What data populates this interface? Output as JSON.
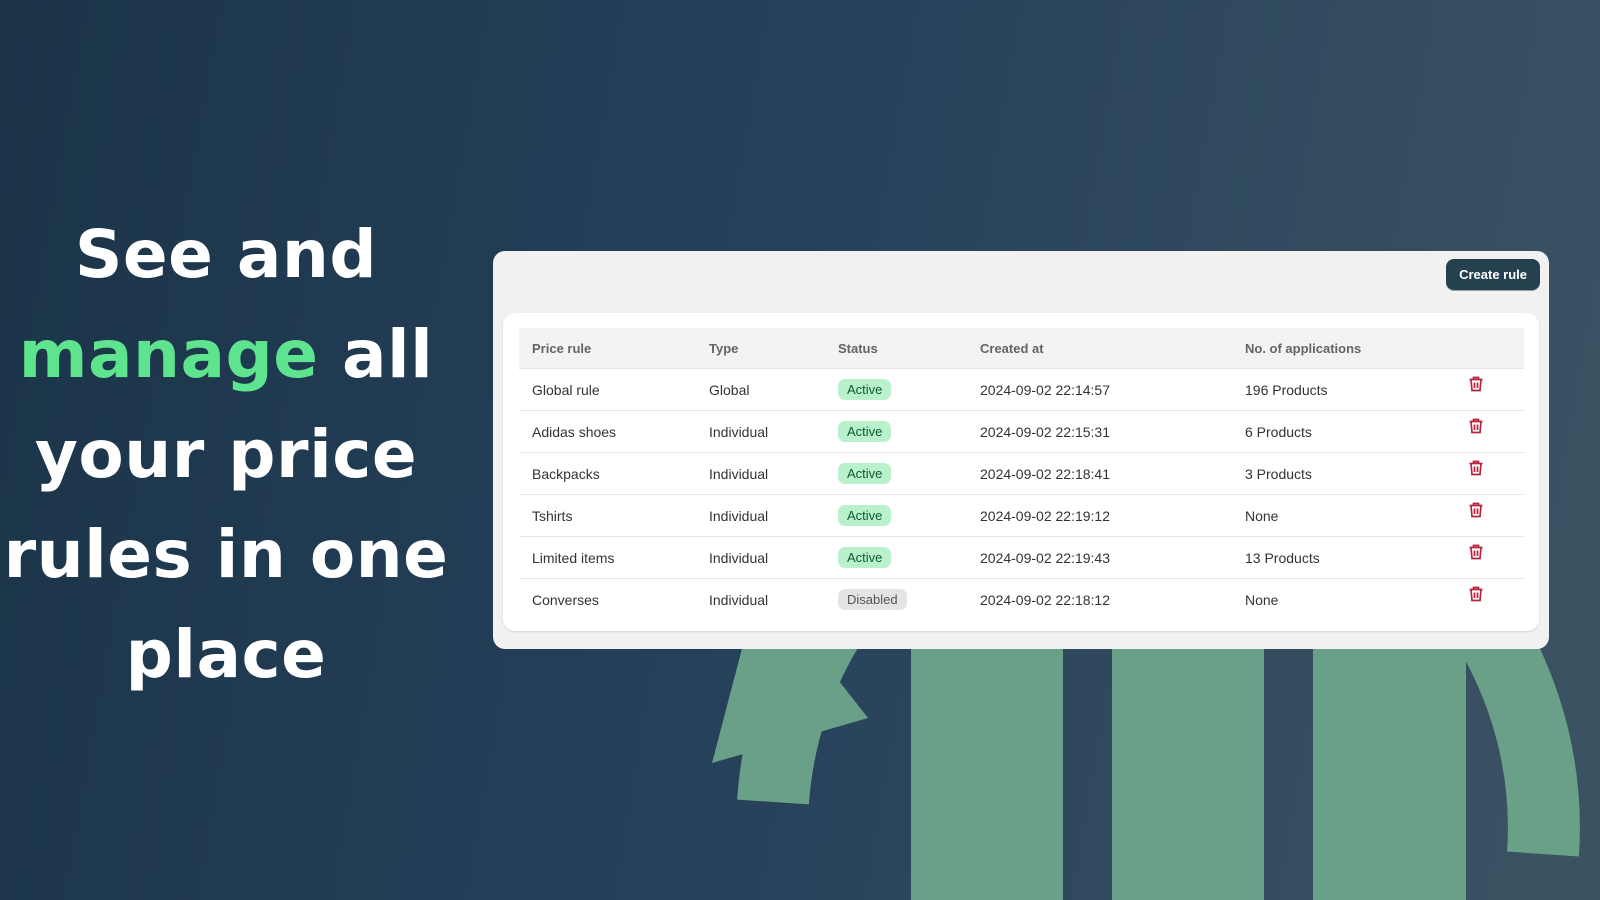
{
  "headline": {
    "line1": "See and",
    "line2_accent": "manage",
    "line2_rest": " all",
    "line3": "your price",
    "line4": "rules in one",
    "line5": "place"
  },
  "toolbar": {
    "create_label": "Create rule"
  },
  "table": {
    "columns": [
      "Price rule",
      "Type",
      "Status",
      "Created at",
      "No. of applications"
    ],
    "rows": [
      {
        "name": "Global rule",
        "type": "Global",
        "status": "Active",
        "status_kind": "active",
        "created": "2024-09-02 22:14:57",
        "applications": "196 Products"
      },
      {
        "name": "Adidas shoes",
        "type": "Individual",
        "status": "Active",
        "status_kind": "active",
        "created": "2024-09-02 22:15:31",
        "applications": "6 Products"
      },
      {
        "name": "Backpacks",
        "type": "Individual",
        "status": "Active",
        "status_kind": "active",
        "created": "2024-09-02 22:18:41",
        "applications": "3 Products"
      },
      {
        "name": "Tshirts",
        "type": "Individual",
        "status": "Active",
        "status_kind": "active",
        "created": "2024-09-02 22:19:12",
        "applications": "None"
      },
      {
        "name": "Limited items",
        "type": "Individual",
        "status": "Active",
        "status_kind": "active",
        "created": "2024-09-02 22:19:43",
        "applications": "13 Products"
      },
      {
        "name": "Converses",
        "type": "Individual",
        "status": "Disabled",
        "status_kind": "disabled",
        "created": "2024-09-02 22:18:12",
        "applications": "None"
      }
    ],
    "row_action_icon": "trash-icon"
  },
  "colors": {
    "accent": "#5ee38f",
    "button": "#25404f",
    "delete_icon": "#b5243a",
    "active_badge": "#b8f1cb",
    "disabled_badge": "#e4e4e4",
    "background_art": "#6a9f88"
  }
}
